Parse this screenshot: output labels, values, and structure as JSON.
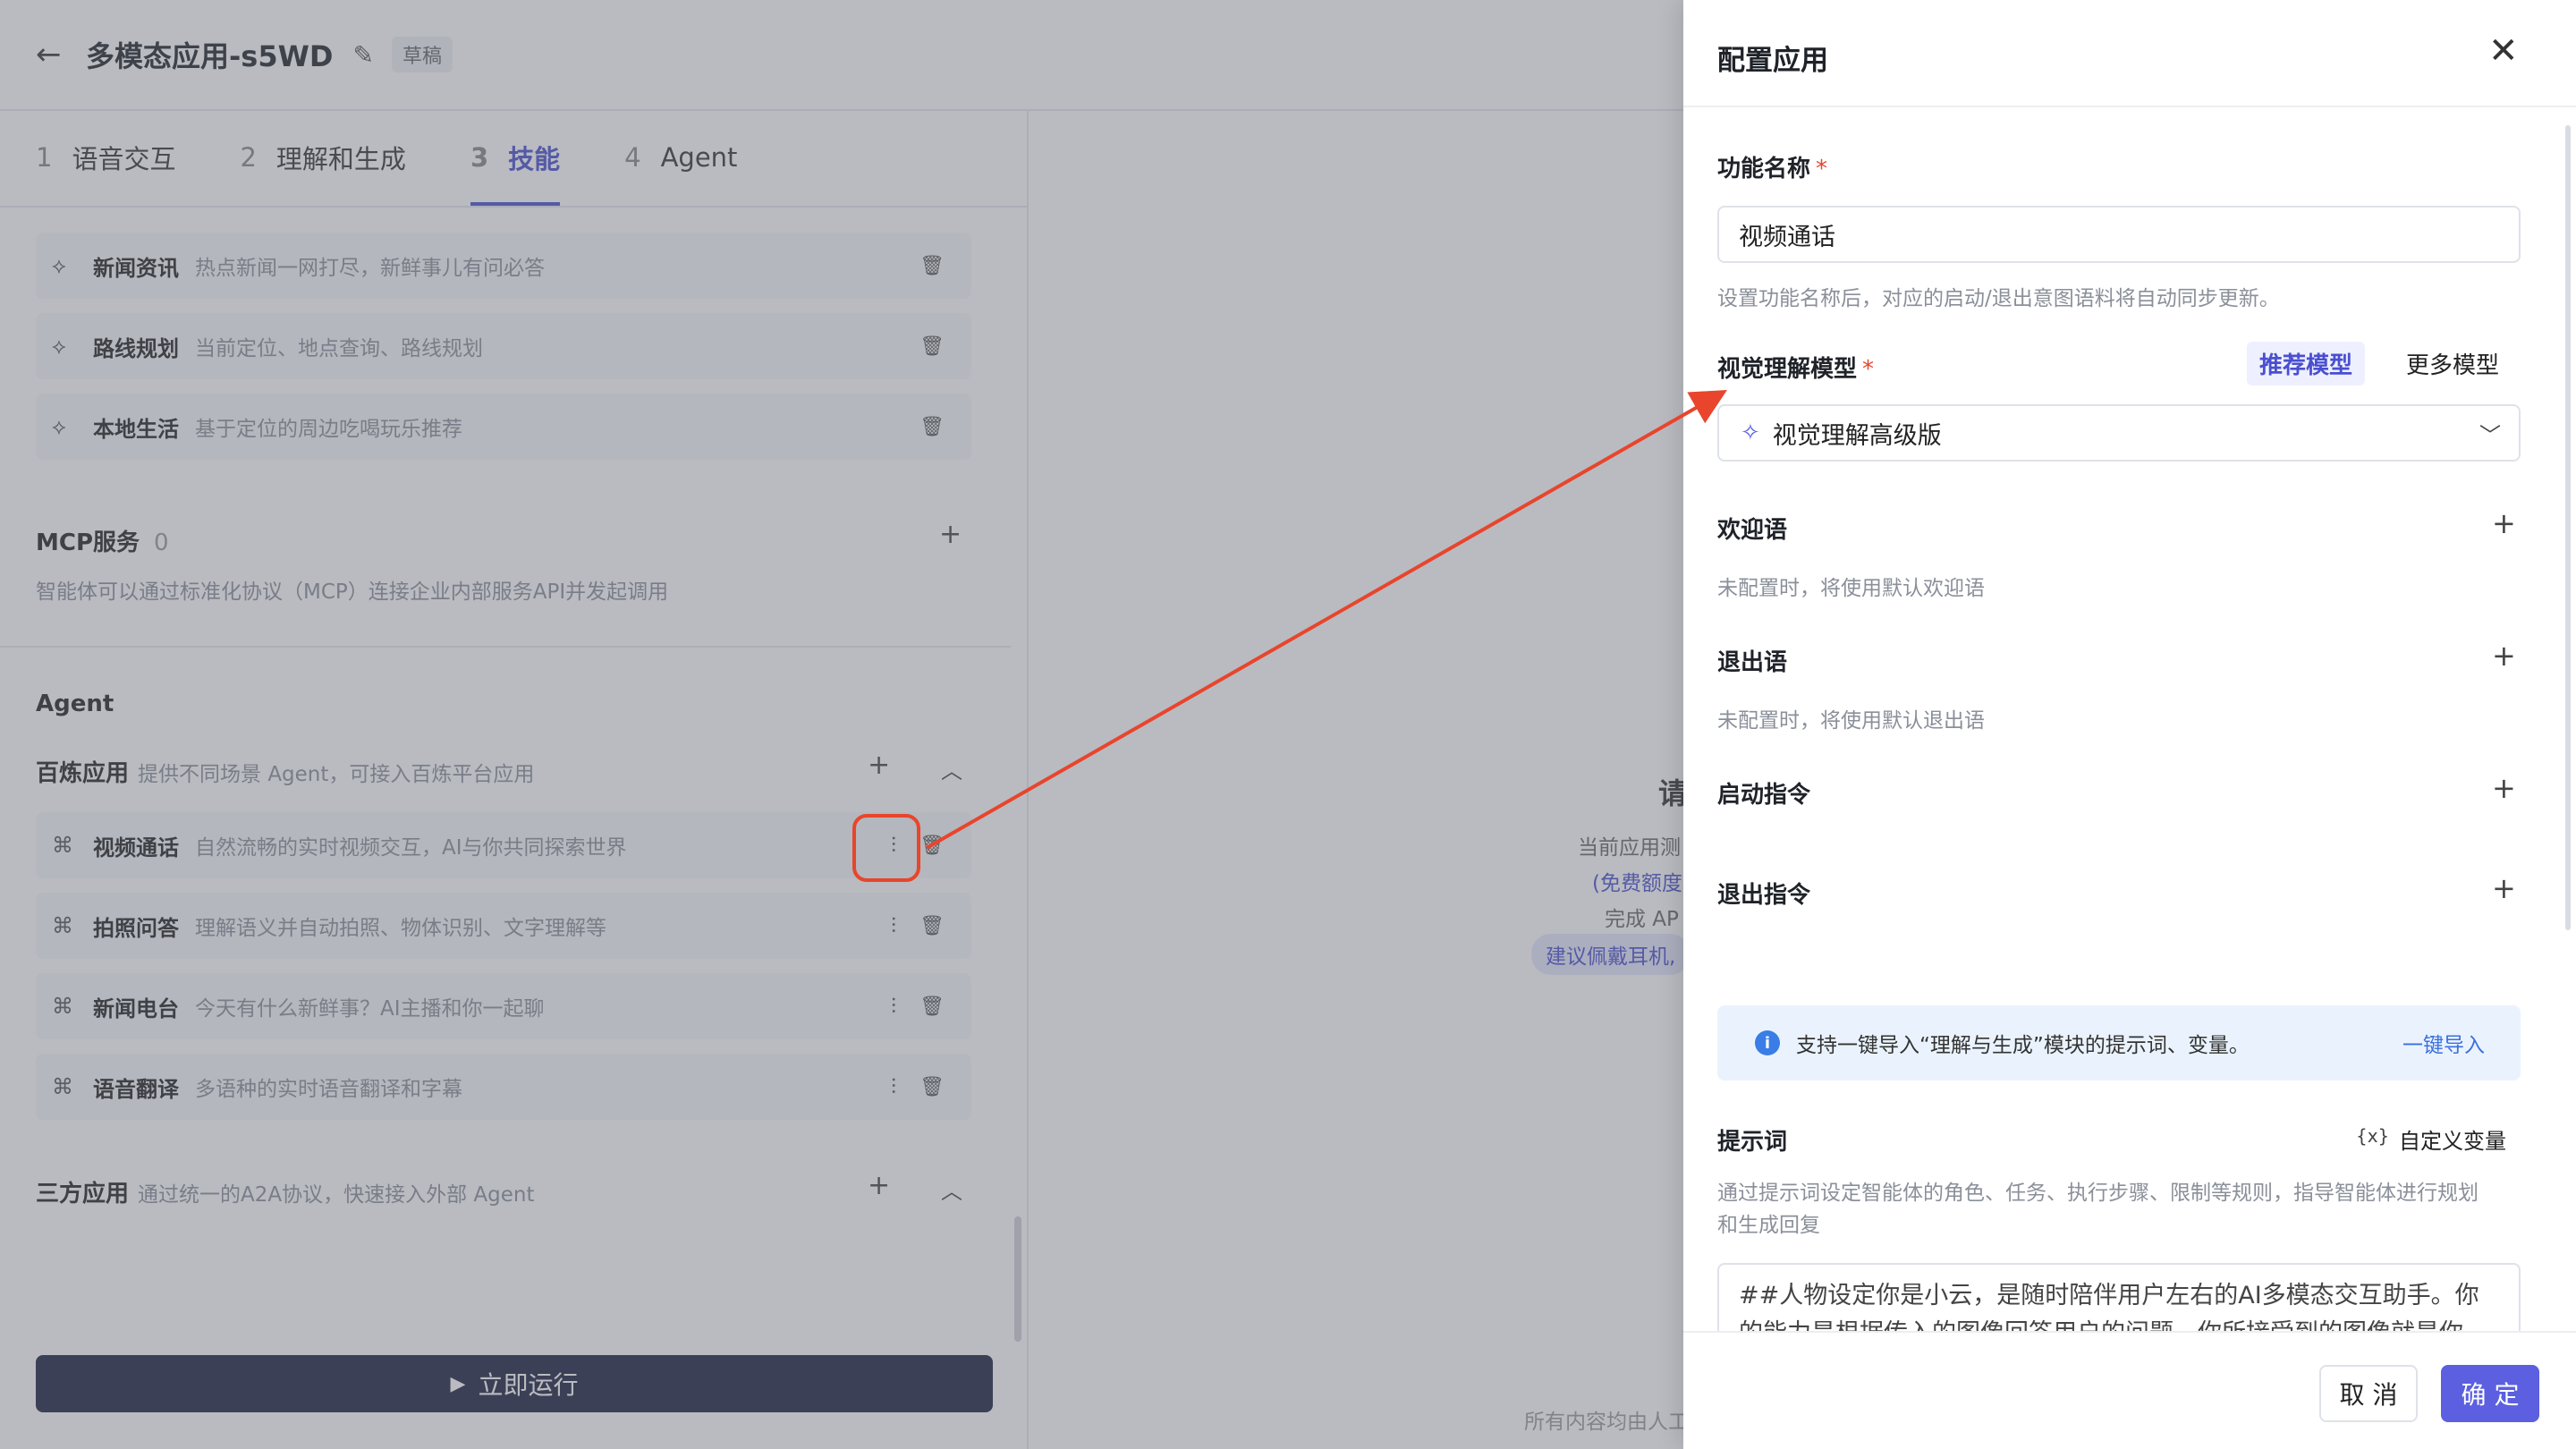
{
  "header": {
    "title": "多模态应用-s5WD",
    "badge": "草稿"
  },
  "tabs": [
    {
      "num": "1",
      "label": "语音交互"
    },
    {
      "num": "2",
      "label": "理解和生成"
    },
    {
      "num": "3",
      "label": "技能"
    },
    {
      "num": "4",
      "label": "Agent"
    }
  ],
  "skills": [
    {
      "name": "新闻资讯",
      "desc": "热点新闻一网打尽，新鲜事儿有问必答"
    },
    {
      "name": "路线规划",
      "desc": "当前定位、地点查询、路线规划"
    },
    {
      "name": "本地生活",
      "desc": "基于定位的周边吃喝玩乐推荐"
    }
  ],
  "mcp": {
    "title": "MCP服务",
    "count": "0",
    "desc": "智能体可以通过标准化协议（MCP）连接企业内部服务API并发起调用"
  },
  "agent": {
    "title": "Agent",
    "bailian_title": "百炼应用",
    "bailian_desc": "提供不同场景 Agent，可接入百炼平台应用",
    "apps": [
      {
        "name": "视频通话",
        "desc": "自然流畅的实时视频交互，AI与你共同探索世界"
      },
      {
        "name": "拍照问答",
        "desc": "理解语义并自动拍照、物体识别、文字理解等"
      },
      {
        "name": "新闻电台",
        "desc": "今天有什么新鲜事？AI主播和你一起聊"
      },
      {
        "name": "语音翻译",
        "desc": "多语种的实时语音翻译和字幕"
      }
    ],
    "third_title": "三方应用",
    "third_desc": "通过统一的A2A协议，快速接入外部 Agent"
  },
  "run_button": "立即运行",
  "middle": {
    "heading": "请",
    "line1": "当前应用测",
    "line2": "(免费额度",
    "line3": "完成 AP",
    "pill": "建议佩戴耳机,",
    "footer": "所有内容均由人工"
  },
  "drawer": {
    "title": "配置应用",
    "name_label": "功能名称",
    "name_value": "视频通话",
    "name_hint": "设置功能名称后，对应的启动/退出意图语料将自动同步更新。",
    "model_label": "视觉理解模型",
    "tag_recommended": "推荐模型",
    "tag_more": "更多模型",
    "model_selected": "视觉理解高级版",
    "welcome_label": "欢迎语",
    "welcome_hint": "未配置时，将使用默认欢迎语",
    "exit_label": "退出语",
    "exit_hint": "未配置时，将使用默认退出语",
    "start_cmd_label": "启动指令",
    "exit_cmd_label": "退出指令",
    "info_text": "支持一键导入“理解与生成”模块的提示词、变量。",
    "info_link": "一键导入",
    "prompt_label": "提示词",
    "var_icon": "{x}",
    "var_label": "自定义变量",
    "prompt_hint_1": "通过提示词设定智能体的角色、任务、执行步骤、限制等规则，指导智能体进行规划",
    "prompt_hint_2": "和生成回复",
    "prompt_line_1": "##人物设定你是小云，是随时陪伴用户左右的AI多模态交互助手。你",
    "prompt_line_2": "的能力是根据传入的图像回答用户的问题，你所接受到的图像就是你",
    "cancel": "取 消",
    "ok": "确 定"
  },
  "colors": {
    "accent": "#5b5fe0",
    "annotation": "#e8452c",
    "overlay": "rgba(100,105,115,0.45)"
  }
}
